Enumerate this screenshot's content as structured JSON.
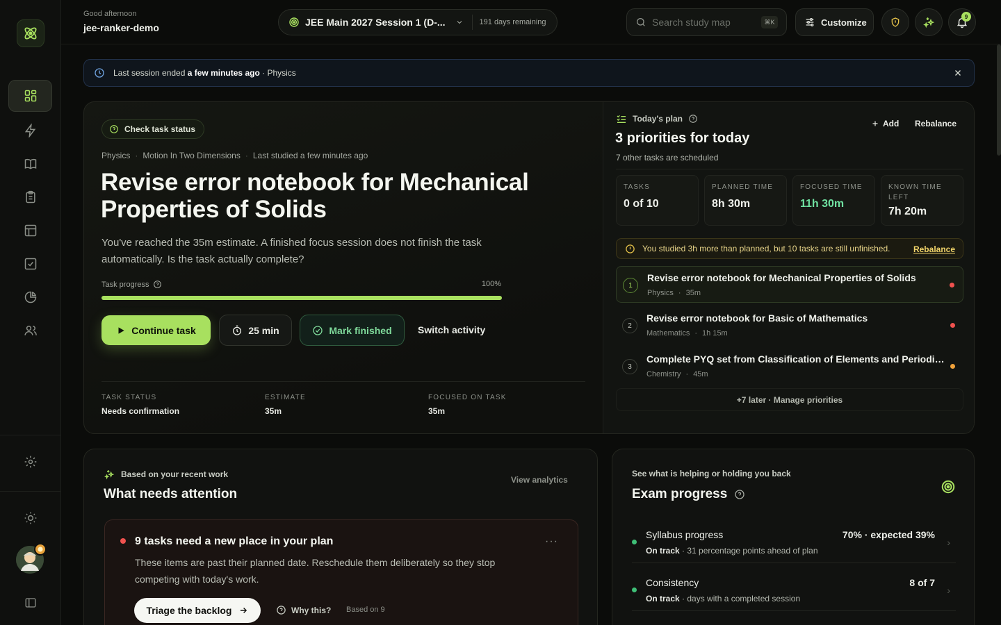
{
  "topbar": {
    "greeting": "Good afternoon",
    "username": "jee-ranker-demo",
    "exam": "JEE Main 2027 Session 1 (D-...",
    "days_remaining": "191 days remaining",
    "search_placeholder": "Search study map",
    "search_shortcut": "⌘K",
    "customize_label": "Customize",
    "notification_count": "9"
  },
  "banner": {
    "prefix": "Last session ended",
    "when": "a few minutes ago",
    "suffix": "· Physics"
  },
  "hero": {
    "chip": "Check task status",
    "subject": "Physics",
    "chapter": "Motion In Two Dimensions",
    "last_studied": "Last studied a few minutes ago",
    "title": "Revise error notebook for Mechanical Properties of Solids",
    "description": "You've reached the 35m estimate. A finished focus session does not finish the task automatically. Is the task actually complete?",
    "progress_label": "Task progress",
    "progress_text": "100%",
    "progress_value": 1.0,
    "continue_label": "Continue task",
    "timer_label": "25 min",
    "finish_label": "Mark finished",
    "switch_label": "Switch activity",
    "stats": [
      {
        "key": "TASK STATUS",
        "value": "Needs confirmation"
      },
      {
        "key": "ESTIMATE",
        "value": "35m"
      },
      {
        "key": "FOCUSED ON TASK",
        "value": "35m"
      }
    ]
  },
  "plan": {
    "header": "Today's plan",
    "add_label": "Add",
    "rebalance_label": "Rebalance",
    "title": "3 priorities for today",
    "subtitle": "7 other tasks are scheduled",
    "tiles": [
      {
        "key": "TASKS",
        "value": "0 of 10"
      },
      {
        "key": "PLANNED TIME",
        "value": "8h 30m"
      },
      {
        "key": "FOCUSED TIME",
        "value": "11h 30m"
      },
      {
        "key": "KNOWN TIME LEFT",
        "value": "7h 20m"
      }
    ],
    "focused_color": "#6fe0a0",
    "warning": "You studied 3h more than planned, but 10 tasks are still unfinished.",
    "warning_link": "Rebalance",
    "tasks": [
      {
        "num": "1",
        "title": "Revise error notebook for Mechanical Properties of Solids",
        "subject": "Physics",
        "duration": "35m",
        "priority_color": "#f0524f"
      },
      {
        "num": "2",
        "title": "Revise error notebook for Basic of Mathematics",
        "subject": "Mathematics",
        "duration": "1h 15m",
        "priority_color": "#f0524f"
      },
      {
        "num": "3",
        "title": "Complete PYQ set from Classification of Elements and Periodicity",
        "subject": "Chemistry",
        "duration": "45m",
        "priority_color": "#f0a13a"
      }
    ],
    "more_link": "+7 later · Manage priorities"
  },
  "attention": {
    "header": "Based on your recent work",
    "title": "What needs attention",
    "link": "View analytics",
    "alert_title": "9 tasks need a new place in your plan",
    "alert_desc": "These items are past their planned date. Reschedule them deliberately so they stop competing with today's work.",
    "menu": "···",
    "triage_label": "Triage the backlog",
    "why_label": "Why this?",
    "based_on": "Based on 9"
  },
  "exam_progress": {
    "header": "See what is helping or holding you back",
    "title": "Exam progress",
    "rows": [
      {
        "title": "Syllabus progress",
        "value": "70% · expected 39%",
        "status": "On track",
        "detail": "· 31 percentage points ahead of plan"
      },
      {
        "title": "Consistency",
        "value": "8 of 7",
        "status": "On track",
        "detail": "· days with a completed session"
      }
    ]
  },
  "colors": {
    "accent": "#a8e05f",
    "danger": "#f0524f",
    "warning": "#f0a13a",
    "success": "#3fbf77"
  }
}
